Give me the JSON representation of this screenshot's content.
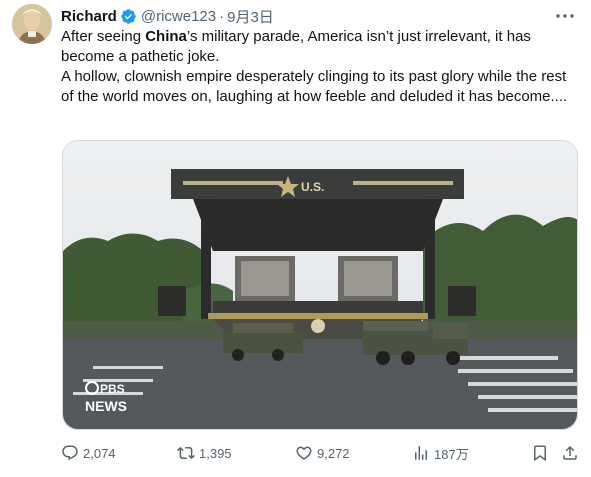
{
  "author": {
    "name": "Richard",
    "handle": "@ricwe123",
    "separator": "·",
    "date": "9月3日"
  },
  "tweet": {
    "line1_pre": "After seeing ",
    "line1_bold": "China",
    "line1_post": "’s military parade, America isn’t just irrelevant, it has become a pathetic joke.",
    "line2": "A hollow, clownish empire desperately clinging to its past glory while the rest of the world moves on, laughing at how feeble and deluded it has become...."
  },
  "media": {
    "stage_banner": "U.S.",
    "watermark_line1": "PBS",
    "watermark_line2": "NEWS"
  },
  "actions": {
    "replies": "2,074",
    "retweets": "1,395",
    "likes": "9,272",
    "views": "187万"
  },
  "icons": [
    "verified-badge-icon",
    "more-icon",
    "reply-icon",
    "retweet-icon",
    "like-icon",
    "views-icon",
    "bookmark-icon",
    "share-icon"
  ],
  "colors": {
    "verified": "#1d9bf0",
    "secondary_text": "#536471",
    "primary_text": "#0f1419"
  }
}
